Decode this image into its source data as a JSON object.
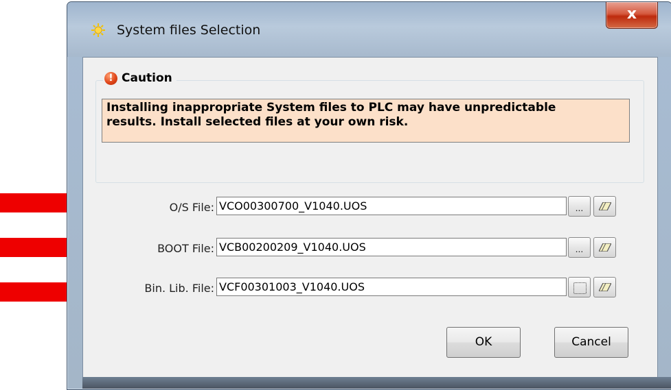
{
  "window": {
    "title": "System files Selection",
    "close_label": "x",
    "app_icon": "sun-icon"
  },
  "caution": {
    "legend": "Caution",
    "icon": "exclamation-circle-icon",
    "message_line1": "Installing inappropriate System files to PLC may have unpredictable",
    "message_line2": "results. Install selected files at your own risk."
  },
  "files": [
    {
      "label": "O/S File:",
      "value": "VCO00300700_V1040.UOS",
      "browse_label": "..."
    },
    {
      "label": "BOOT File:",
      "value": "VCB00200209_V1040.UOS",
      "browse_label": "..."
    },
    {
      "label": "Bin. Lib. File:",
      "value": "VCF00301003_V1040.UOS",
      "browse_label": ""
    }
  ],
  "buttons": {
    "ok": "OK",
    "cancel": "Cancel"
  },
  "colors": {
    "warning_background": "#fce0c9",
    "arrow_red": "#ee0000",
    "close_red": "#c8391a"
  },
  "annotations": {
    "arrows": [
      "red-arrow-icon",
      "red-arrow-icon",
      "red-arrow-icon"
    ]
  }
}
